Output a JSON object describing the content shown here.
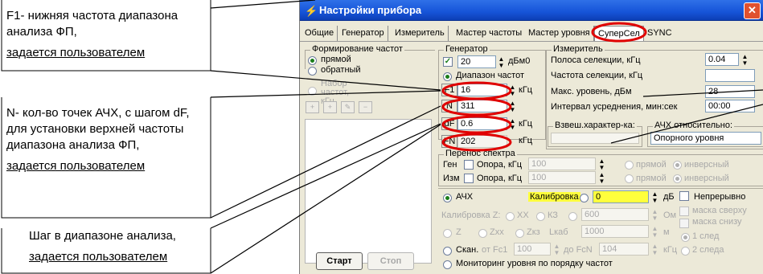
{
  "callouts": {
    "c1": {
      "line1": "F1- нижняя частота диапазона",
      "line2": "анализа ФП,",
      "link": "задается пользователем"
    },
    "c2": {
      "line1": "N- кол-во точек АЧХ, с шагом dF,",
      "line2": "для установки верхней частоты",
      "line3": "диапазона анализа ФП,",
      "link": "задается  пользователем"
    },
    "c3": {
      "line1": "Шаг в диапазоне анализа,",
      "link": "задается пользователем"
    }
  },
  "window": {
    "title": "Настройки прибора",
    "close": "✕"
  },
  "tabs": [
    "Общие",
    "Генератор",
    "Измеритель",
    "Мастер частоты",
    "Мастер уровня",
    "СуперСел",
    "SYNC"
  ],
  "active_tab": "СуперСел",
  "formation": {
    "title": "Формирование частот",
    "opt1": "прямой",
    "opt2": "обратный",
    "set_label": "Набор частот, кГц"
  },
  "generator": {
    "title": "Генератор",
    "level": "20",
    "level_unit": "дБм0",
    "range_label": "Диапазон частот"
  },
  "params": {
    "f1": {
      "tag": "F1",
      "value": "16",
      "unit": "кГц"
    },
    "n": {
      "tag": "N",
      "value": "311"
    },
    "df": {
      "tag": "dF",
      "value": "0.6",
      "unit": "кГц"
    },
    "fn": {
      "tag": "FN",
      "value": "202",
      "unit": "кГц"
    }
  },
  "meter": {
    "title": "Измеритель",
    "bw_label": "Полоса селекции, кГц",
    "bw_value": "0.04",
    "freq_label": "Частота селекции, кГц",
    "max_label": "Макс. уровень, дБм",
    "max_value": "28",
    "avg_label": "Интервал усреднения, мин:сек",
    "avg_value": "00:00",
    "weight_label": "Взвеш.характер-ка:",
    "afc_rel_label": "АЧХ относительно:",
    "afc_rel_value": "Опорного уровня"
  },
  "transfer": {
    "title": "Перенос спектра",
    "gen_label": "Ген",
    "gen_ref": "Опора, кГц",
    "gen_value": "100",
    "meas_label": "Изм",
    "meas_ref": "Опора, кГц",
    "meas_value": "100",
    "direct": "прямой",
    "inverse": "инверсный"
  },
  "afc": {
    "label": "АЧХ",
    "calib_label": "Калибровка",
    "calib_value": "0",
    "db": "дБ",
    "continuous": "Непрерывно"
  },
  "calibz": {
    "label": "Калибровка Z:",
    "xx": "XX",
    "kz": "КЗ",
    "value": "600",
    "unit": "Ом"
  },
  "zrow": {
    "z": "Z",
    "zxx": "Zхх",
    "zkz": "Zкз",
    "lcab": "Lкаб",
    "value": "1000",
    "unit": "м"
  },
  "scan": {
    "label": "Скан.",
    "from": "от Fc1",
    "from_value": "100",
    "to": "до FcN",
    "to_value": "104",
    "unit": "кГц"
  },
  "monitor": {
    "label": "Мониторинг  уровня по порядку частот"
  },
  "masks": {
    "top": "маска сверху",
    "bottom": "маска снизу",
    "trace1": "1 след",
    "trace2": "2 следа"
  },
  "buttons": {
    "start": "Старт",
    "stop": "Стоп"
  },
  "colors": {
    "title_bar": "#1654d8",
    "window_bg": "#ece9d8",
    "highlight": "#ffff3c",
    "annotation": "#e00000"
  }
}
